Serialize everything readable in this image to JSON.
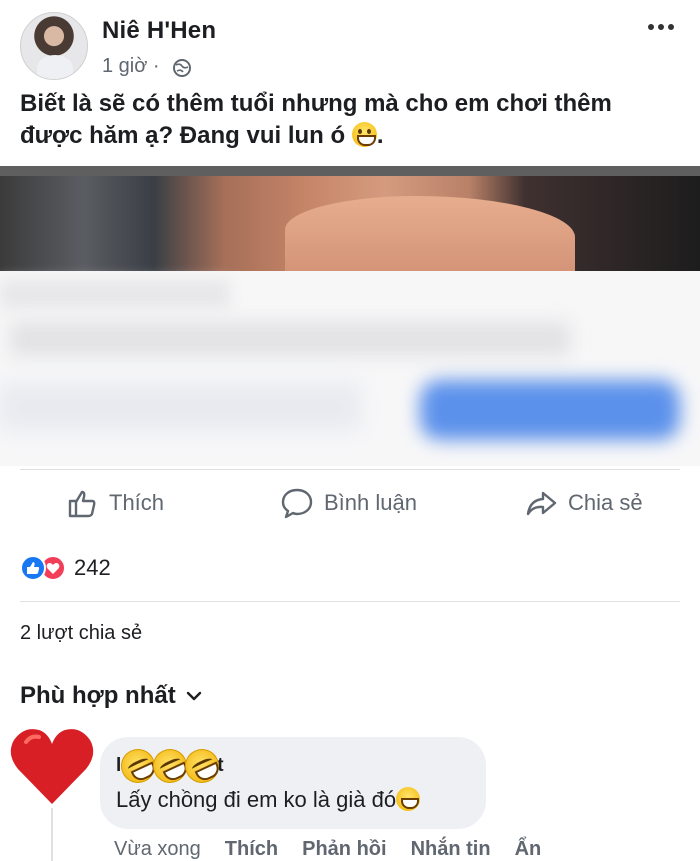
{
  "post": {
    "author": "Niê H'Hen",
    "time": "1 giờ ·",
    "text_before_emoji": "Biết là sẽ có thêm tuổi nhưng mà cho em chơi thêm được hăm ạ? Đang vui lun ó ",
    "text_after_emoji": "."
  },
  "actions": {
    "like": "Thích",
    "comment": "Bình luận",
    "share": "Chia sẻ"
  },
  "stats": {
    "reactions": "242",
    "shares": "2 lượt chia sẻ"
  },
  "comments": {
    "sort_label": "Phù hợp nhất",
    "first": {
      "name_start": "l",
      "name_end": "t",
      "text": "Lấy chồng đi em ko là già đó",
      "time": "Vừa xong",
      "like": "Thích",
      "reply": "Phản hồi",
      "message": "Nhắn tin",
      "hide": "Ẩn"
    }
  },
  "icons": {
    "post_menu": "more-icon",
    "privacy": "globe-icon",
    "like": "thumbs-up-icon",
    "comment": "comment-icon",
    "share": "share-icon",
    "sort": "chevron-down-icon"
  },
  "colors": {
    "facebook_blue": "#1877f2",
    "love_red": "#f33e58",
    "muted_text": "#606770",
    "comment_bubble": "#eef0f3"
  }
}
